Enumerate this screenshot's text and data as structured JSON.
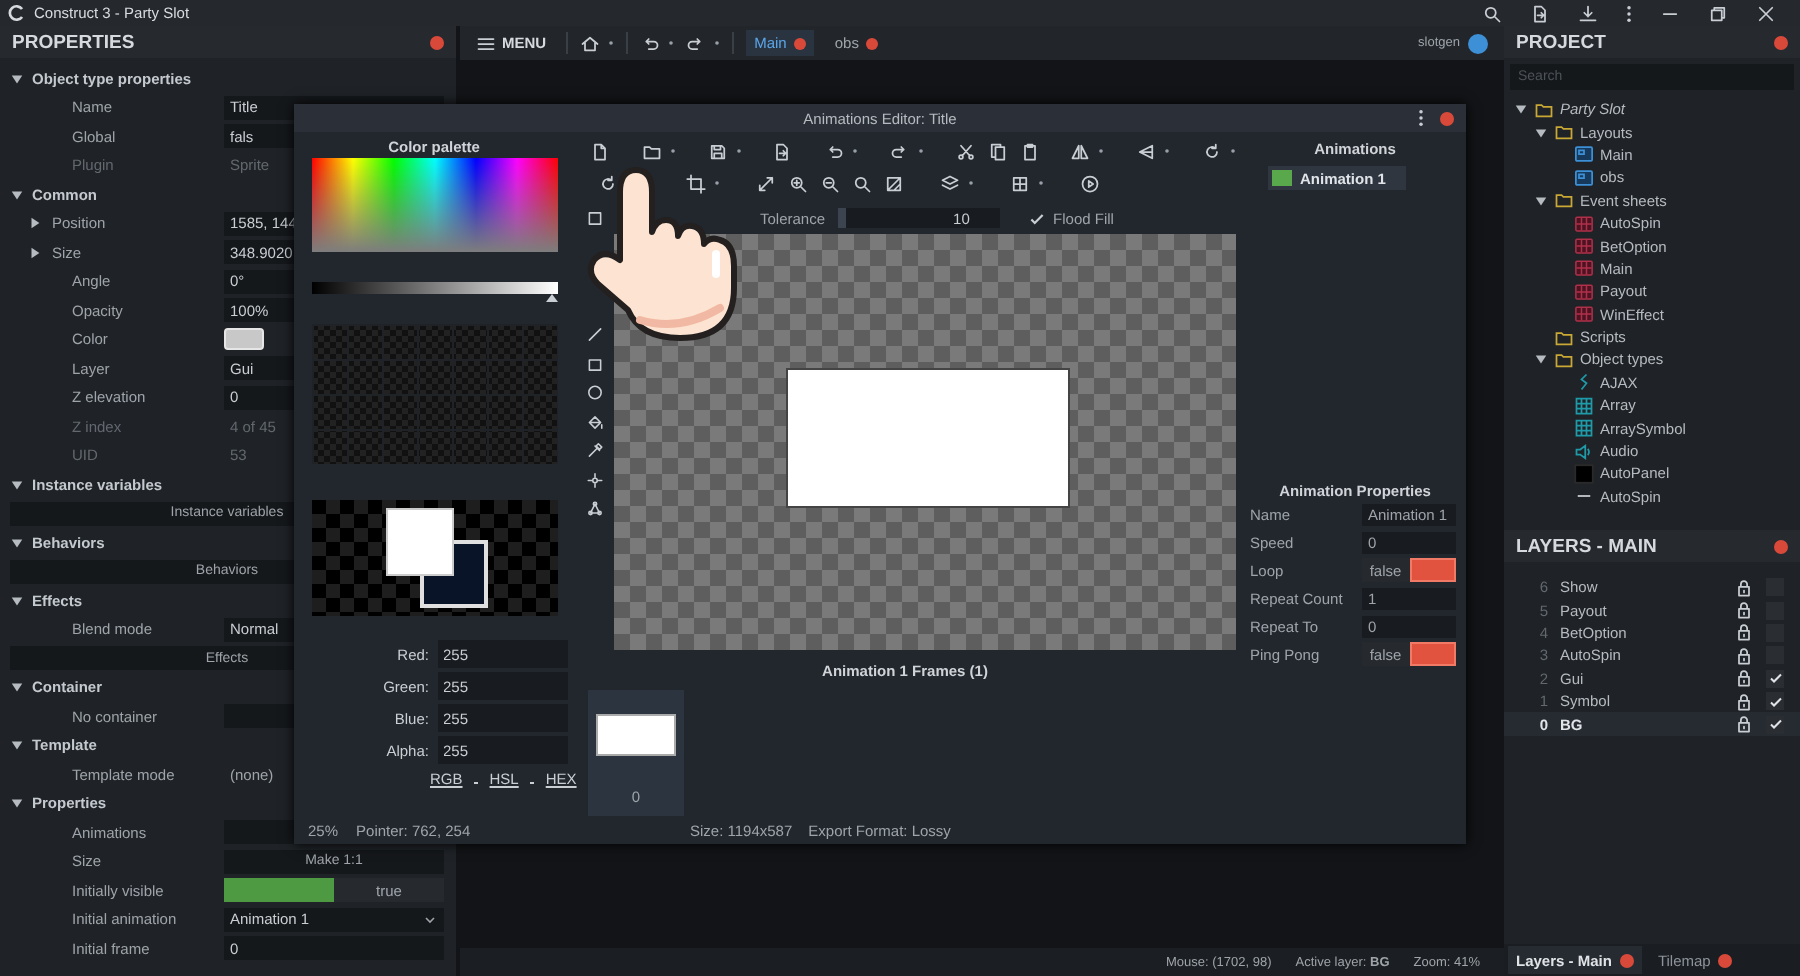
{
  "window": {
    "title": "Construct 3 - Party Slot"
  },
  "properties_panel": {
    "title": "PROPERTIES",
    "rows": [
      {
        "kind": "section",
        "label": "Object type properties",
        "expanded": true
      },
      {
        "kind": "field",
        "label": "Name",
        "value": "Title"
      },
      {
        "kind": "field",
        "label": "Global",
        "value": "fals"
      },
      {
        "kind": "readonly",
        "label": "Plugin",
        "value": "Sprite"
      },
      {
        "kind": "section",
        "label": "Common",
        "expanded": true
      },
      {
        "kind": "group",
        "label": "Position",
        "value": "1585, 144",
        "expanded": false
      },
      {
        "kind": "group",
        "label": "Size",
        "value": "348.9020",
        "expanded": false
      },
      {
        "kind": "field",
        "label": "Angle",
        "value": "0°"
      },
      {
        "kind": "field",
        "label": "Opacity",
        "value": "100%"
      },
      {
        "kind": "color",
        "label": "Color"
      },
      {
        "kind": "field",
        "label": "Layer",
        "value": "Gui"
      },
      {
        "kind": "field",
        "label": "Z elevation",
        "value": "0"
      },
      {
        "kind": "readonly",
        "label": "Z index",
        "value": "4 of 45"
      },
      {
        "kind": "readonly",
        "label": "UID",
        "value": "53"
      },
      {
        "kind": "section",
        "label": "Instance variables",
        "expanded": true
      },
      {
        "kind": "button",
        "value": "Instance variables"
      },
      {
        "kind": "section",
        "label": "Behaviors",
        "expanded": true
      },
      {
        "kind": "button",
        "value": "Behaviors"
      },
      {
        "kind": "section",
        "label": "Effects",
        "expanded": true
      },
      {
        "kind": "field",
        "label": "Blend mode",
        "value": "Normal"
      },
      {
        "kind": "button",
        "value": "Effects"
      },
      {
        "kind": "section",
        "label": "Container",
        "expanded": true
      },
      {
        "kind": "field",
        "label": "No container"
      },
      {
        "kind": "section",
        "label": "Template",
        "expanded": true
      },
      {
        "kind": "plain",
        "label": "Template mode",
        "value": "(none)"
      },
      {
        "kind": "section",
        "label": "Properties",
        "expanded": true
      },
      {
        "kind": "field",
        "label": "Animations"
      },
      {
        "kind": "button",
        "label": "Size",
        "value": "Make 1:1"
      },
      {
        "kind": "toggle",
        "label": "Initially visible",
        "value": "true",
        "on": true
      },
      {
        "kind": "dropdown",
        "label": "Initial animation",
        "value": "Animation 1"
      },
      {
        "kind": "field",
        "label": "Initial frame",
        "value": "0"
      }
    ]
  },
  "main_toolbar": {
    "menu": "MENU",
    "tabs": [
      {
        "label": "Main",
        "selected": true
      },
      {
        "label": "obs",
        "selected": false
      }
    ],
    "user": "slotgen"
  },
  "status_bar": {
    "mouse": "Mouse: (1702, 98)",
    "layer": "Active layer: **BG**",
    "zoom": "Zoom: 41%"
  },
  "animations_editor": {
    "title": "Animations Editor: Title",
    "color_palette": {
      "title": "Color palette",
      "brightness": {
        "level": 1
      },
      "channels": [
        {
          "label": "Red:",
          "value": "255"
        },
        {
          "label": "Green:",
          "value": "255"
        },
        {
          "label": "Blue:",
          "value": "255"
        },
        {
          "label": "Alpha:",
          "value": "255"
        }
      ],
      "modes": [
        "RGB",
        "HSL",
        "HEX"
      ]
    },
    "zoom": "25%",
    "pointer": "Pointer: 762, 254",
    "tolerance": {
      "label": "Tolerance",
      "value": "10",
      "level": 0.08
    },
    "flood_fill": {
      "label": "Flood Fill",
      "checked": true
    },
    "frames": {
      "title": "Animation 1 Frames (1)",
      "items": [
        {
          "label": "0",
          "selected": true
        }
      ]
    },
    "size": "Size: 1194x587",
    "export": "Export Format: Lossy",
    "animations": {
      "title": "Animations",
      "items": [
        {
          "name": "Animation 1",
          "selected": true
        }
      ]
    },
    "animation_properties": {
      "title": "Animation Properties",
      "rows": [
        {
          "kind": "field",
          "label": "Name",
          "value": "Animation 1"
        },
        {
          "kind": "field",
          "label": "Speed",
          "value": "0"
        },
        {
          "kind": "toggle",
          "label": "Loop",
          "value": "false",
          "on": false
        },
        {
          "kind": "field",
          "label": "Repeat Count",
          "value": "1"
        },
        {
          "kind": "field",
          "label": "Repeat To",
          "value": "0"
        },
        {
          "kind": "toggle",
          "label": "Ping Pong",
          "value": "false",
          "on": false
        }
      ]
    }
  },
  "project": {
    "title": "PROJECT",
    "search_placeholder": "Search",
    "tree": [
      {
        "label": "Party Slot",
        "kind": "root",
        "expanded": true,
        "children": [
          {
            "label": "Layouts",
            "kind": "folder",
            "expanded": true,
            "children": [
              {
                "label": "Main",
                "kind": "layout"
              },
              {
                "label": "obs",
                "kind": "layout"
              }
            ]
          },
          {
            "label": "Event sheets",
            "kind": "folder",
            "expanded": true,
            "children": [
              {
                "label": "AutoSpin",
                "kind": "events"
              },
              {
                "label": "BetOption",
                "kind": "events"
              },
              {
                "label": "Main",
                "kind": "events"
              },
              {
                "label": "Payout",
                "kind": "events"
              },
              {
                "label": "WinEffect",
                "kind": "events"
              }
            ]
          },
          {
            "label": "Scripts",
            "kind": "folder"
          },
          {
            "label": "Object types",
            "kind": "folder",
            "expanded": true,
            "children": [
              {
                "label": "AJAX",
                "kind": "ajax"
              },
              {
                "label": "Array",
                "kind": "array"
              },
              {
                "label": "ArraySymbol",
                "kind": "array"
              },
              {
                "label": "Audio",
                "kind": "audio"
              },
              {
                "label": "AutoPanel",
                "kind": "sprite"
              },
              {
                "label": "AutoSpin",
                "kind": "text"
              }
            ]
          }
        ]
      }
    ]
  },
  "layers": {
    "title": "LAYERS - MAIN",
    "items": [
      {
        "index": "6",
        "name": "Show",
        "visible": false,
        "selected": false
      },
      {
        "index": "5",
        "name": "Payout",
        "visible": false,
        "selected": false
      },
      {
        "index": "4",
        "name": "BetOption",
        "visible": false,
        "selected": false
      },
      {
        "index": "3",
        "name": "AutoSpin",
        "visible": false,
        "selected": false
      },
      {
        "index": "2",
        "name": "Gui",
        "visible": true,
        "selected": false
      },
      {
        "index": "1",
        "name": "Symbol",
        "visible": true,
        "selected": false
      },
      {
        "index": "0",
        "name": "BG",
        "visible": true,
        "selected": true
      }
    ]
  },
  "bottom_tabs": [
    {
      "label": "Layers - Main",
      "selected": true
    },
    {
      "label": "Tilemap",
      "selected": false
    }
  ]
}
